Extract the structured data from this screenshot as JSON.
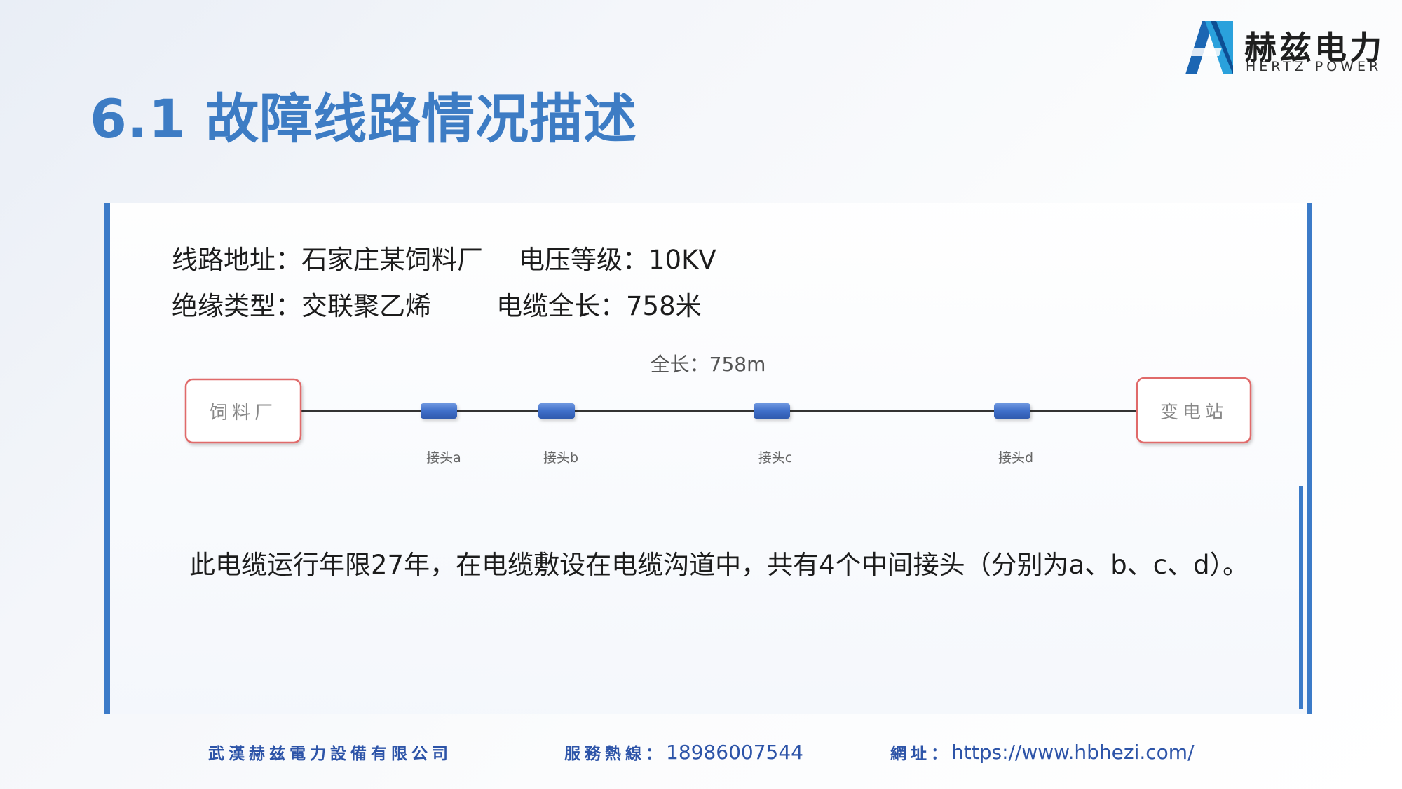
{
  "header": {
    "title": "6.1 故障线路情况描述",
    "logo_cn": "赫兹电力",
    "logo_en": "HERTZ POWER"
  },
  "info": {
    "address_label": "线路地址：",
    "address_value": "石家庄某饲料厂",
    "voltage_label": "电压等级：",
    "voltage_value": "10KV",
    "insulation_label": "绝缘类型：",
    "insulation_value": "交联聚乙烯",
    "length_label": "电缆全长：",
    "length_value": "758米"
  },
  "diagram": {
    "total_length": "全长：758m",
    "left_node": "饲料厂",
    "right_node": "变电站",
    "joints": [
      "接头a",
      "接头b",
      "接头c",
      "接头d"
    ]
  },
  "summary": "此电缆运行年限27年，在电缆敷设在电缆沟道中，共有4个中间接头（分别为a、b、c、d）。",
  "footer": {
    "company": "武漢赫兹電力設備有限公司",
    "hotline_label": "服務熱線：",
    "hotline_value": "18986007544",
    "website_label": "網址：",
    "website_value": "https://www.hbhezi.com/"
  },
  "colors": {
    "accent": "#3c7bc8",
    "title": "#3d7cc4",
    "node_border": "#e06a6a",
    "joint": "#3f6fc9"
  }
}
